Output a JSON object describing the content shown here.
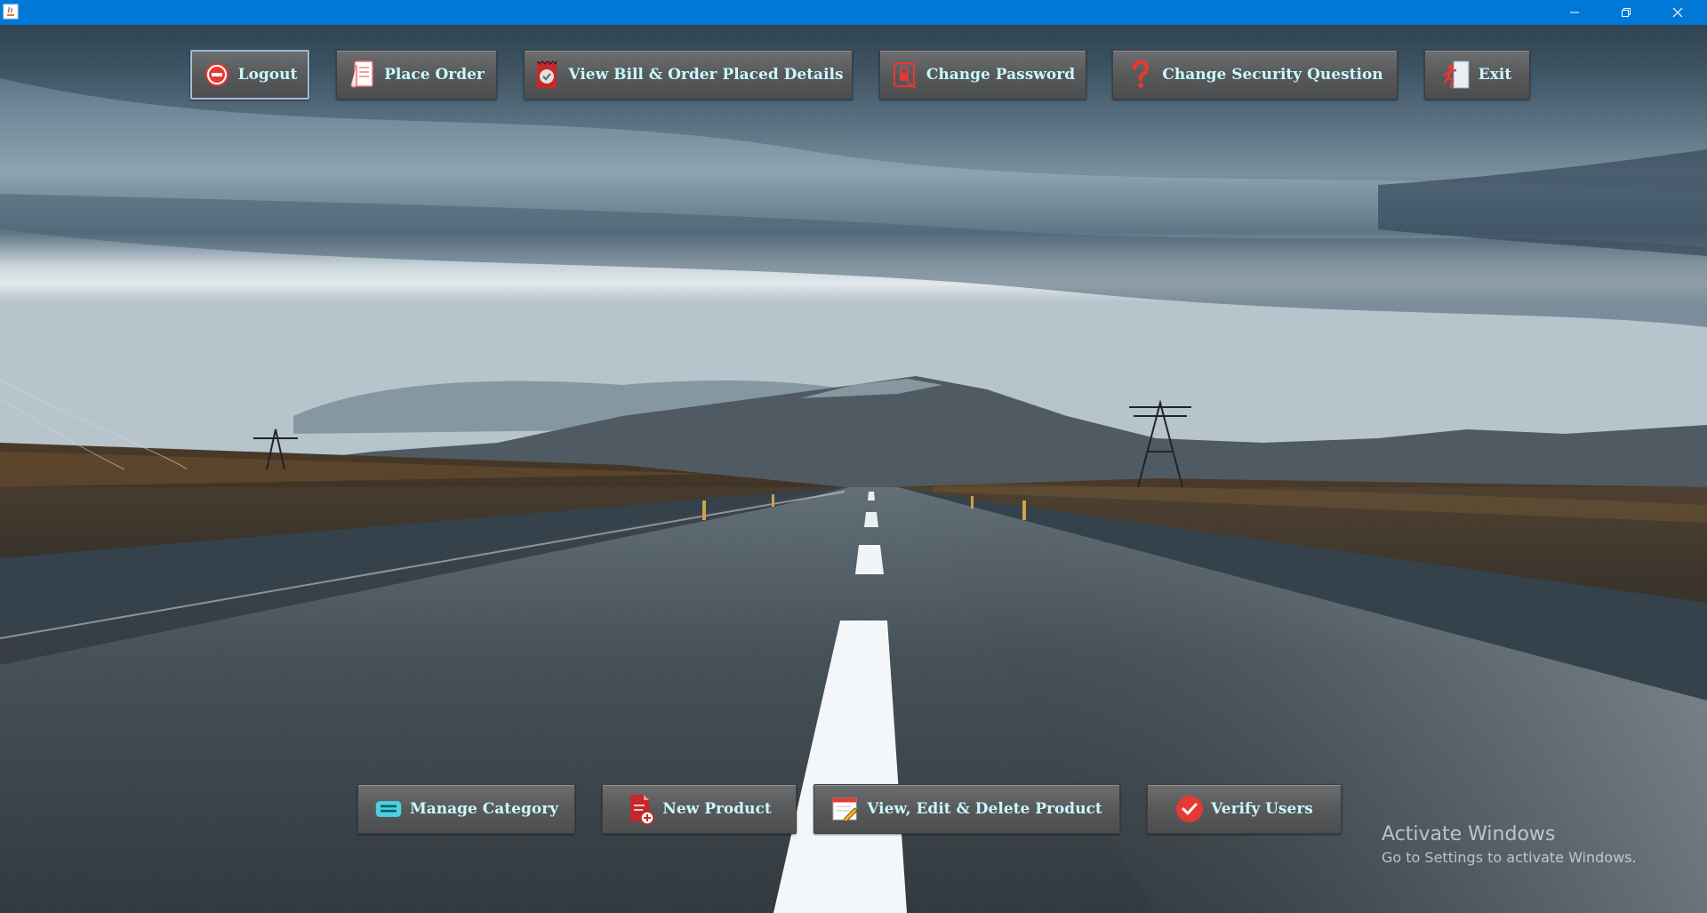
{
  "window": {
    "titlebar_color": "#0078d7",
    "controls": {
      "minimize_icon": "minimize-icon",
      "maximize_icon": "restore-icon",
      "close_icon": "close-icon"
    }
  },
  "top_toolbar": {
    "buttons": [
      {
        "label": "Logout",
        "icon": "logout-icon"
      },
      {
        "label": "Place Order",
        "icon": "scroll-icon"
      },
      {
        "label": "View Bill & Order Placed Details",
        "icon": "bill-icon"
      },
      {
        "label": "Change Password",
        "icon": "password-lock-icon"
      },
      {
        "label": "Change Security Question",
        "icon": "question-mark-icon"
      },
      {
        "label": "Exit",
        "icon": "exit-door-icon"
      }
    ]
  },
  "admin_toolbar": {
    "buttons": [
      {
        "label": "Manage Category",
        "icon": "category-icon"
      },
      {
        "label": "New Product",
        "icon": "new-document-icon"
      },
      {
        "label": "View, Edit & Delete Product",
        "icon": "edit-notepad-icon"
      },
      {
        "label": "Verify Users",
        "icon": "checkmark-icon"
      }
    ]
  },
  "watermark": {
    "line1": "Activate Windows",
    "line2": "Go to Settings to activate Windows."
  },
  "colors": {
    "button_text": "#c8f8ff",
    "button_face": "#5a5b5d",
    "accent_red": "#e53935"
  }
}
